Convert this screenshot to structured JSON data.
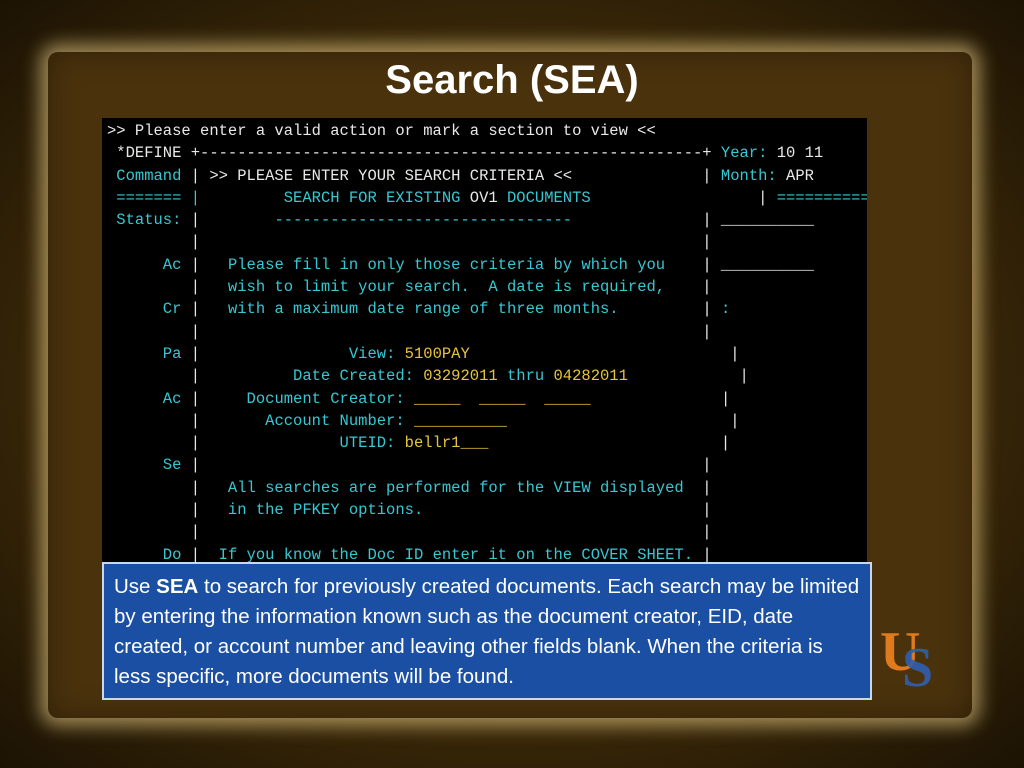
{
  "slide": {
    "title": "Search (SEA)"
  },
  "terminal": {
    "lines": [
      [
        {
          "t": ">> Please enter a valid action or mark a section to view <<",
          "c": "w"
        }
      ],
      [
        {
          "t": " *DEFINE +------------------------------------------------------+ ",
          "c": "w"
        },
        {
          "t": "Year:",
          "c": "c"
        },
        {
          "t": " 10 11",
          "c": "w"
        }
      ],
      [
        {
          "t": " Command",
          "c": "c"
        },
        {
          "t": " | >> PLEASE ENTER YOUR SEARCH CRITERIA <<              | ",
          "c": "w"
        },
        {
          "t": "Month:",
          "c": "c"
        },
        {
          "t": " APR",
          "c": "w"
        }
      ],
      [
        {
          "t": " ======= | ",
          "c": "c"
        },
        {
          "t": "        SEARCH FOR EXISTING ",
          "c": "c"
        },
        {
          "t": "OV1",
          "c": "w"
        },
        {
          "t": " DOCUMENTS",
          "c": "c"
        },
        {
          "t": "                  | ",
          "c": "w"
        },
        {
          "t": "==========",
          "c": "c"
        }
      ],
      [
        {
          "t": " Status:",
          "c": "c"
        },
        {
          "t": " |        ",
          "c": "w"
        },
        {
          "t": "--------------------------------",
          "c": "c"
        },
        {
          "t": "              | ",
          "c": "w"
        },
        {
          "t": "__________",
          "c": "w"
        }
      ],
      [
        {
          "t": "         |                                                      |",
          "c": "w"
        }
      ],
      [
        {
          "t": "      Ac",
          "c": "c"
        },
        {
          "t": " |   ",
          "c": "w"
        },
        {
          "t": "Please fill in only those criteria by which you",
          "c": "c"
        },
        {
          "t": "    | ",
          "c": "w"
        },
        {
          "t": "__________",
          "c": "w"
        }
      ],
      [
        {
          "t": "         |   ",
          "c": "w"
        },
        {
          "t": "wish to limit your search.  A date is required,",
          "c": "c"
        },
        {
          "t": "    |",
          "c": "w"
        }
      ],
      [
        {
          "t": "      Cr",
          "c": "c"
        },
        {
          "t": " |   ",
          "c": "w"
        },
        {
          "t": "with a maximum date range of three months.",
          "c": "c"
        },
        {
          "t": "         | ",
          "c": "w"
        },
        {
          "t": ":",
          "c": "c"
        }
      ],
      [
        {
          "t": "         |                                                      |",
          "c": "w"
        }
      ],
      [
        {
          "t": "      Pa",
          "c": "c"
        },
        {
          "t": " |                ",
          "c": "w"
        },
        {
          "t": "View:",
          "c": "c"
        },
        {
          "t": " 5100PAY",
          "c": "y"
        },
        {
          "t": "                            |",
          "c": "w"
        }
      ],
      [
        {
          "t": "         |          ",
          "c": "w"
        },
        {
          "t": "Date Created:",
          "c": "c"
        },
        {
          "t": " 03292011 ",
          "c": "y"
        },
        {
          "t": "thru",
          "c": "c"
        },
        {
          "t": " 04282011",
          "c": "y"
        },
        {
          "t": "            |",
          "c": "w"
        }
      ],
      [
        {
          "t": "      Ac",
          "c": "c"
        },
        {
          "t": " |     ",
          "c": "w"
        },
        {
          "t": "Document Creator:",
          "c": "c"
        },
        {
          "t": " _____  _____  _____",
          "c": "y"
        },
        {
          "t": "              |",
          "c": "w"
        }
      ],
      [
        {
          "t": "         |       ",
          "c": "w"
        },
        {
          "t": "Account Number:",
          "c": "c"
        },
        {
          "t": " __________",
          "c": "y"
        },
        {
          "t": "                        |",
          "c": "w"
        }
      ],
      [
        {
          "t": "         |               ",
          "c": "w"
        },
        {
          "t": "UTEID:",
          "c": "c"
        },
        {
          "t": " bellr1___",
          "c": "y"
        },
        {
          "t": "                         |",
          "c": "w"
        }
      ],
      [
        {
          "t": "      Se",
          "c": "c"
        },
        {
          "t": " |                                                      |",
          "c": "w"
        }
      ],
      [
        {
          "t": "         |   ",
          "c": "w"
        },
        {
          "t": "All searches are performed for the VIEW displayed",
          "c": "c"
        },
        {
          "t": "  |",
          "c": "w"
        }
      ],
      [
        {
          "t": "         |   ",
          "c": "w"
        },
        {
          "t": "in the PFKEY options.",
          "c": "c"
        },
        {
          "t": "                              |",
          "c": "w"
        }
      ],
      [
        {
          "t": "         |                                                      |",
          "c": "w"
        }
      ],
      [
        {
          "t": "      Do",
          "c": "c"
        },
        {
          "t": " |  ",
          "c": "w"
        },
        {
          "t": "If you know the Doc ID enter it on the COVER SHEET.",
          "c": "c"
        },
        {
          "t": " |",
          "c": "w"
        }
      ]
    ]
  },
  "callout": {
    "prefix": "Use ",
    "keyword": "SEA",
    "rest": " to search for previously created documents. Each search may be limited by entering the information known such as the document creator, EID, date created, or account number and leaving other fields blank. When the criteria is less specific, more documents will be found."
  },
  "logo": {
    "text": "US",
    "colors": {
      "u": "#e07a1e",
      "s": "#2f5fb0"
    }
  }
}
